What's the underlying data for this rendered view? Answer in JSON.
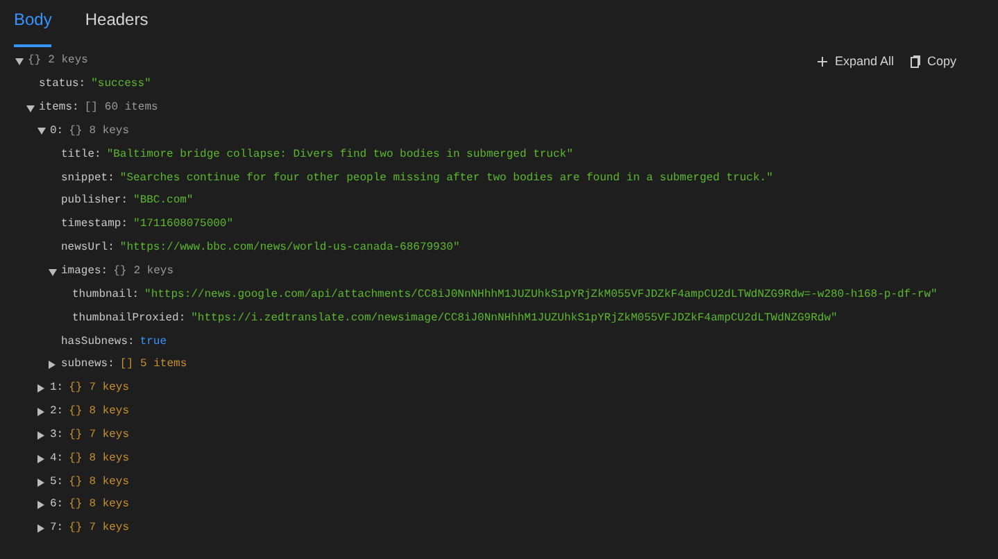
{
  "tabs": [
    {
      "label": "Body",
      "selected": true
    },
    {
      "label": "Headers",
      "selected": false
    }
  ],
  "toolbar": [
    {
      "kind": "expand",
      "label": "Expand All"
    },
    {
      "kind": "copy",
      "label": "Copy"
    }
  ],
  "tree": {
    "expanded": true,
    "brackets": "{}",
    "count": "2 keys",
    "children": [
      {
        "key": "status:",
        "kind": "string",
        "value": "\"success\""
      },
      {
        "key": "items:",
        "expanded": true,
        "brackets": "[]",
        "count": "60 items",
        "children": [
          {
            "key": "0:",
            "expanded": true,
            "brackets": "{}",
            "count": "8 keys",
            "children": [
              {
                "key": "title:",
                "kind": "string",
                "value": "\"Baltimore bridge collapse: Divers find two bodies in submerged truck\""
              },
              {
                "key": "snippet:",
                "kind": "string",
                "value": "\"Searches continue for four other people missing after two bodies are found in a submerged truck.\""
              },
              {
                "key": "publisher:",
                "kind": "string",
                "value": "\"BBC.com\""
              },
              {
                "key": "timestamp:",
                "kind": "string",
                "value": "\"1711608075000\""
              },
              {
                "key": "newsUrl:",
                "kind": "string",
                "value": "\"https://www.bbc.com/news/world-us-canada-68679930\""
              },
              {
                "key": "images:",
                "expanded": true,
                "brackets": "{}",
                "count": "2 keys",
                "children": [
                  {
                    "key": "thumbnail:",
                    "kind": "string",
                    "value": "\"https://news.google.com/api/attachments/CC8iJ0NnNHhhM1JUZUhkS1pYRjZkM055VFJDZkF4ampCU2dLTWdNZG9Rdw=-w280-h168-p-df-rw\""
                  },
                  {
                    "key": "thumbnailProxied:",
                    "kind": "string",
                    "value": "\"https://i.zedtranslate.com/newsimage/CC8iJ0NnNHhhM1JUZUhkS1pYRjZkM055VFJDZkF4ampCU2dLTWdNZG9Rdw\""
                  }
                ]
              },
              {
                "key": "hasSubnews:",
                "kind": "boolean",
                "value": "true"
              },
              {
                "key": "subnews:",
                "expanded": false,
                "brackets": "[]",
                "count": "5 items"
              }
            ]
          },
          {
            "key": "1:",
            "expanded": false,
            "brackets": "{}",
            "count": "7 keys"
          },
          {
            "key": "2:",
            "expanded": false,
            "brackets": "{}",
            "count": "8 keys"
          },
          {
            "key": "3:",
            "expanded": false,
            "brackets": "{}",
            "count": "7 keys"
          },
          {
            "key": "4:",
            "expanded": false,
            "brackets": "{}",
            "count": "8 keys"
          },
          {
            "key": "5:",
            "expanded": false,
            "brackets": "{}",
            "count": "8 keys"
          },
          {
            "key": "6:",
            "expanded": false,
            "brackets": "{}",
            "count": "8 keys"
          },
          {
            "key": "7:",
            "expanded": false,
            "brackets": "{}",
            "count": "7 keys"
          }
        ]
      }
    ]
  }
}
